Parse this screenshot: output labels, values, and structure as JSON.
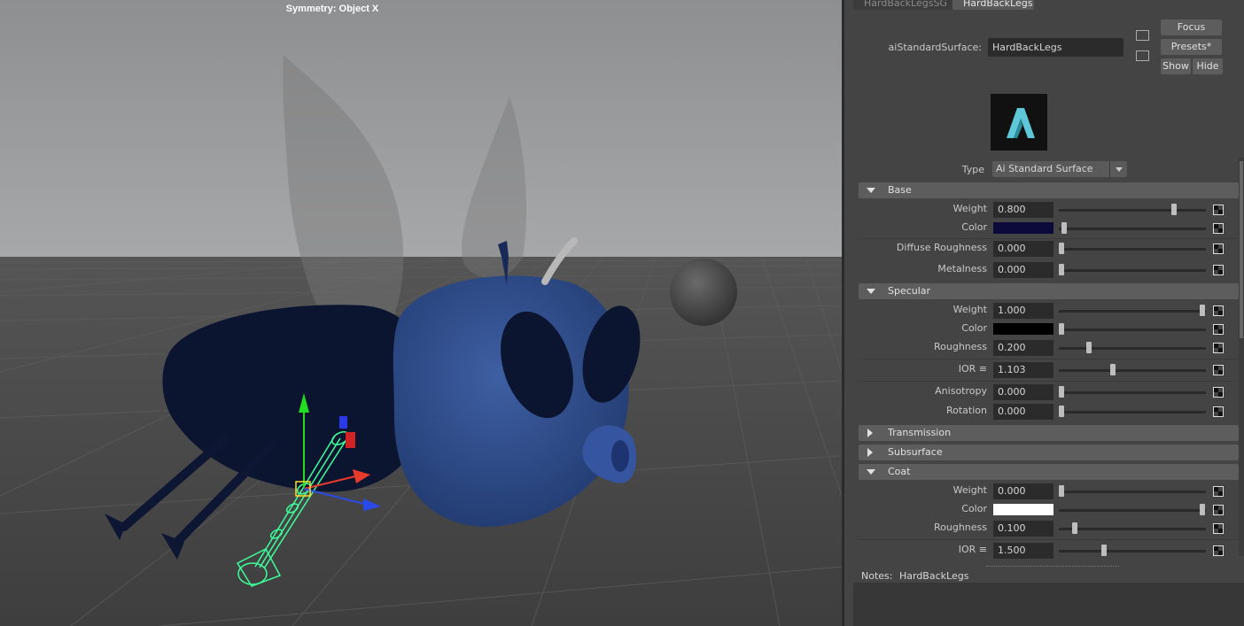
{
  "viewport": {
    "symmetry_text": "Symmetry: Object X"
  },
  "tabs": [
    "HardBackLegsSG",
    "HardBackLegs"
  ],
  "header": {
    "shader_label": "aiStandardSurface:",
    "shader_name": "HardBackLegs",
    "focus": "Focus",
    "presets": "Presets*",
    "show": "Show",
    "hide": "Hide"
  },
  "type_label": "Type",
  "type_value": "Ai Standard Surface",
  "sections": {
    "base": "Base",
    "specular": "Specular",
    "transmission": "Transmission",
    "subsurface": "Subsurface",
    "coat": "Coat"
  },
  "base": {
    "weight_label": "Weight",
    "weight": "0.800",
    "weight_pos": 0.8,
    "color_label": "Color",
    "color_hex": "#0b0a3a",
    "diffuse_roughness_label": "Diffuse Roughness",
    "diffuse_roughness": "0.000",
    "metalness_label": "Metalness",
    "metalness": "0.000"
  },
  "specular": {
    "weight_label": "Weight",
    "weight": "1.000",
    "color_label": "Color",
    "color_hex": "#000000",
    "roughness_label": "Roughness",
    "roughness": "0.200",
    "ior_label": "IOR ≡",
    "ior": "1.103",
    "anisotropy_label": "Anisotropy",
    "anisotropy": "0.000",
    "rotation_label": "Rotation",
    "rotation": "0.000"
  },
  "coat": {
    "weight_label": "Weight",
    "weight": "0.000",
    "color_label": "Color",
    "color_hex": "#ffffff",
    "roughness_label": "Roughness",
    "roughness": "0.100",
    "ior_label": "IOR ≡",
    "ior": "1.500"
  },
  "notes": {
    "label": "Notes:",
    "value": "HardBackLegs"
  },
  "colors": {
    "sky": "#9a9b9d",
    "ground": "#484848",
    "body_dark": "#0b1530",
    "head_blue": "#2c4a86",
    "wireframe": "#3dff9a"
  }
}
